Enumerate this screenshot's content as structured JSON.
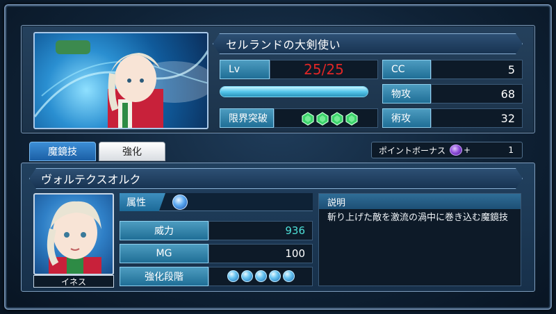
{
  "character": {
    "title": "セルランドの大剣使い",
    "lv_label": "Lv",
    "lv_value": "25/25",
    "exp_fraction": 1.0,
    "limit_label": "限界突破",
    "limit_gems": 4,
    "stats": [
      {
        "label": "CC",
        "value": "5"
      },
      {
        "label": "物攻",
        "value": "68"
      },
      {
        "label": "術攻",
        "value": "32"
      }
    ]
  },
  "tabs": [
    {
      "label": "魔鏡技",
      "active": true
    },
    {
      "label": "強化",
      "active": false
    }
  ],
  "bonus": {
    "label": "ポイントボーナス",
    "plus": "+",
    "value": "1",
    "icon": "bonus-orb-icon"
  },
  "skill": {
    "name": "ヴォルテクスオルク",
    "portrait_name": "イネス",
    "attr_label": "属性",
    "attr_icon": "water-element-icon",
    "rows": [
      {
        "label": "威力",
        "value": "936",
        "value_color": "#4ee0d8"
      },
      {
        "label": "MG",
        "value": "100",
        "value_color": "#ffffff"
      }
    ],
    "enhance_label": "強化段階",
    "enhance_orbs": 5,
    "desc_label": "説明",
    "description": "斬り上げた敵を激流の渦中に巻き込む魔鏡技"
  },
  "colors": {
    "lv_value": "#e02626",
    "accent": "#7fd9f4",
    "gem": "#3bd36a"
  }
}
